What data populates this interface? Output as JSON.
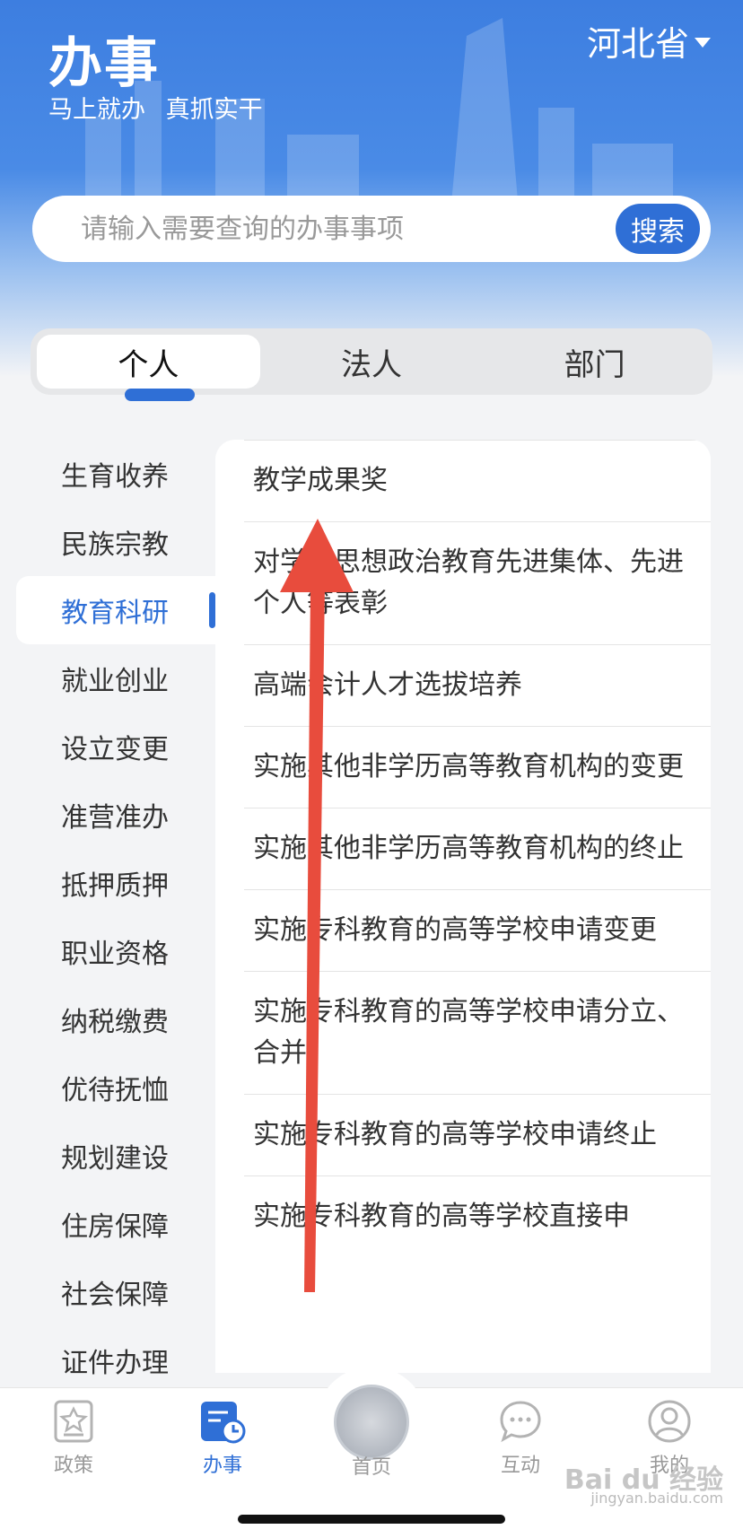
{
  "header": {
    "title": "办事",
    "slogan": "马上就办 真抓实干",
    "province": "河北省"
  },
  "search": {
    "placeholder": "请输入需要查询的办事事项",
    "button": "搜索"
  },
  "tabs": [
    {
      "label": "个人",
      "active": true
    },
    {
      "label": "法人",
      "active": false
    },
    {
      "label": "部门",
      "active": false
    }
  ],
  "sidebar": {
    "items": [
      "生育收养",
      "民族宗教",
      "教育科研",
      "就业创业",
      "设立变更",
      "准营准办",
      "抵押质押",
      "职业资格",
      "纳税缴费",
      "优待抚恤",
      "规划建设",
      "住房保障",
      "社会保障",
      "证件办理"
    ],
    "active": "教育科研"
  },
  "list": {
    "items": [
      "教学成果奖",
      "对学校思想政治教育先进集体、先进个人等表彰",
      "高端会计人才选拔培养",
      "实施其他非学历高等教育机构的变更",
      "实施其他非学历高等教育机构的终止",
      "实施专科教育的高等学校申请变更",
      "实施专科教育的高等学校申请分立、合并",
      "实施专科教育的高等学校申请终止",
      "实施专科教育的高等学校直接申"
    ]
  },
  "bottom_nav": [
    {
      "label": "政策",
      "icon": "policy-icon"
    },
    {
      "label": "办事",
      "icon": "affairs-icon",
      "active": true
    },
    {
      "label": "首页",
      "icon": "emblem-icon"
    },
    {
      "label": "互动",
      "icon": "chat-icon"
    },
    {
      "label": "我的",
      "icon": "user-icon"
    }
  ],
  "annotation": {
    "color": "#e84c3d"
  },
  "watermark": {
    "brand": "Bai du 经验",
    "url": "jingyan.baidu.com"
  }
}
